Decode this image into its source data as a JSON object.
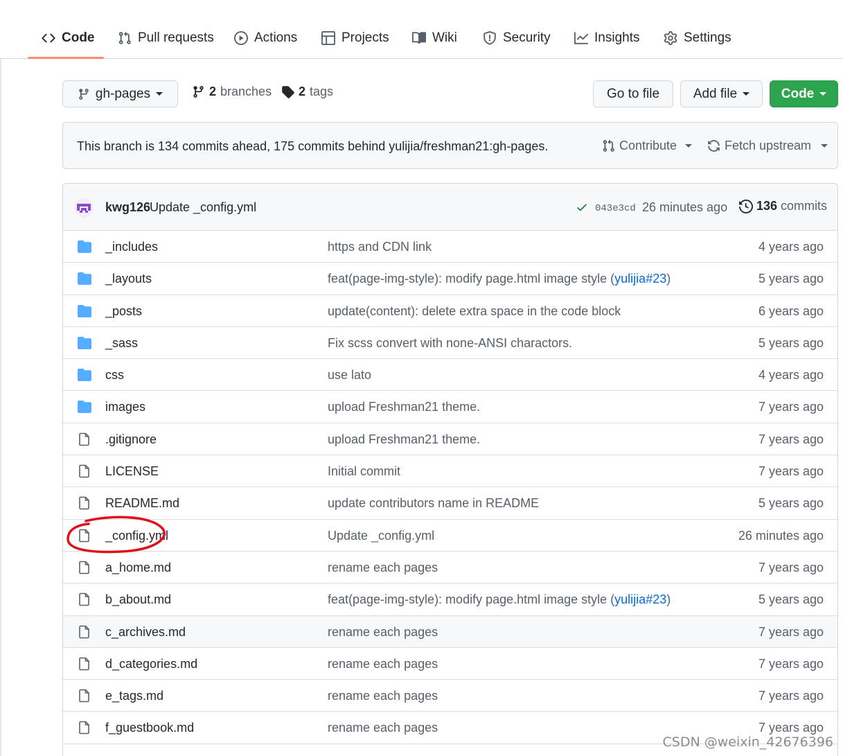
{
  "nav": {
    "tabs": [
      {
        "label": "Code",
        "icon": "code-icon",
        "selected": true
      },
      {
        "label": "Pull requests",
        "icon": "pull-request-icon"
      },
      {
        "label": "Actions",
        "icon": "play-icon"
      },
      {
        "label": "Projects",
        "icon": "table-icon"
      },
      {
        "label": "Wiki",
        "icon": "book-icon"
      },
      {
        "label": "Security",
        "icon": "shield-icon"
      },
      {
        "label": "Insights",
        "icon": "graph-icon"
      },
      {
        "label": "Settings",
        "icon": "gear-icon"
      }
    ]
  },
  "branch_bar": {
    "branch": "gh-pages",
    "branches_count": "2",
    "branches_label": "branches",
    "tags_count": "2",
    "tags_label": "tags",
    "go_to_file": "Go to file",
    "add_file": "Add file",
    "code": "Code"
  },
  "ahead": {
    "text": "This branch is 134 commits ahead, 175 commits behind yulijia/freshman21:gh-pages.",
    "contribute": "Contribute",
    "fetch": "Fetch upstream"
  },
  "latest_commit": {
    "author": "kwg126",
    "message": "Update _config.yml",
    "sha": "043e3cd",
    "time": "26 minutes ago",
    "commits_count": "136",
    "commits_label": "commits"
  },
  "files": [
    {
      "name": "_includes",
      "type": "dir",
      "message": "https and CDN link",
      "age": "4 years ago"
    },
    {
      "name": "_layouts",
      "type": "dir",
      "message": "feat(page-img-style): modify page.html image style (",
      "link": "yulijia#23",
      "suffix": ")",
      "age": "5 years ago"
    },
    {
      "name": "_posts",
      "type": "dir",
      "message": "update(content): delete extra space in the code block",
      "age": "6 years ago"
    },
    {
      "name": "_sass",
      "type": "dir",
      "message": "Fix scss convert with none-ANSI charactors.",
      "age": "5 years ago"
    },
    {
      "name": "css",
      "type": "dir",
      "message": "use lato",
      "age": "4 years ago"
    },
    {
      "name": "images",
      "type": "dir",
      "message": "upload Freshman21 theme.",
      "age": "7 years ago"
    },
    {
      "name": ".gitignore",
      "type": "file",
      "message": "upload Freshman21 theme.",
      "age": "7 years ago"
    },
    {
      "name": "LICENSE",
      "type": "file",
      "message": "Initial commit",
      "age": "7 years ago"
    },
    {
      "name": "README.md",
      "type": "file",
      "message": "update contributors name in README",
      "age": "5 years ago"
    },
    {
      "name": "_config.yml",
      "type": "file",
      "message": "Update _config.yml",
      "age": "26 minutes ago"
    },
    {
      "name": "a_home.md",
      "type": "file",
      "message": "rename each pages",
      "age": "7 years ago"
    },
    {
      "name": "b_about.md",
      "type": "file",
      "message": "feat(page-img-style): modify page.html image style (",
      "link": "yulijia#23",
      "suffix": ")",
      "age": "5 years ago"
    },
    {
      "name": "c_archives.md",
      "type": "file",
      "message": "rename each pages",
      "age": "7 years ago",
      "highlight": true
    },
    {
      "name": "d_categories.md",
      "type": "file",
      "message": "rename each pages",
      "age": "7 years ago"
    },
    {
      "name": "e_tags.md",
      "type": "file",
      "message": "rename each pages",
      "age": "7 years ago"
    },
    {
      "name": "f_guestbook.md",
      "type": "file",
      "message": "rename each pages",
      "age": "7 years ago"
    }
  ],
  "watermark": "CSDN @weixin_42676396",
  "colors": {
    "accent": "#2da44e",
    "link": "#0969da",
    "folder": "#54aeff",
    "underline": "#fd8c73",
    "annotation": "#e0111a"
  }
}
